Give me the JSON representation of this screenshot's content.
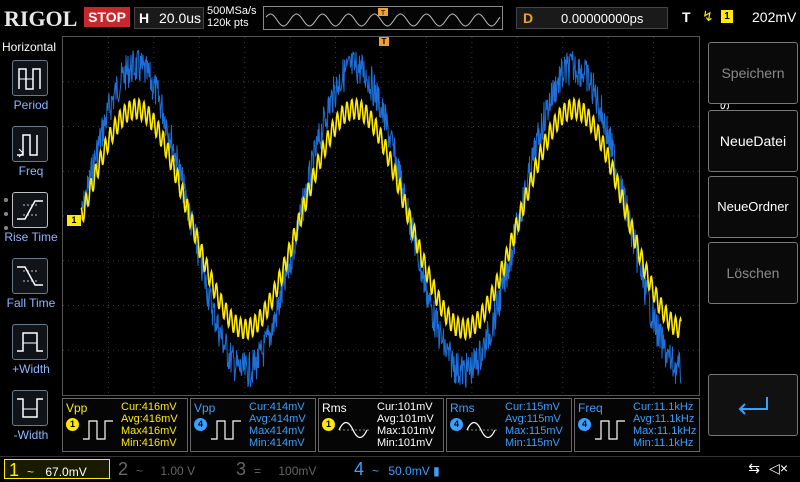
{
  "header": {
    "brand": "RIGOL",
    "run_state": "STOP",
    "horizontal_key": "H",
    "timebase": "20.0us",
    "sample_rate": "500MSa/s",
    "memory_depth": "120k pts",
    "delay_key": "D",
    "delay_value": "0.00000000ps",
    "trigger_key": "T",
    "trigger_edge": "↯",
    "trigger_channel": "1",
    "trigger_level": "202mV"
  },
  "left_menu": {
    "title": "Horizontal",
    "items": [
      {
        "label": "Period",
        "icon": "period-icon"
      },
      {
        "label": "Freq",
        "icon": "frequency-icon"
      },
      {
        "label": "Rise Time",
        "icon": "rise-time-icon"
      },
      {
        "label": "Fall Time",
        "icon": "fall-time-icon"
      },
      {
        "label": "+Width",
        "icon": "positive-width-icon"
      },
      {
        "label": "-Width",
        "icon": "negative-width-icon"
      }
    ]
  },
  "right_menu": {
    "title": "Speichern",
    "buttons": [
      {
        "label": "Speichern",
        "state": "dim"
      },
      {
        "label": "NeueDatei",
        "state": "on"
      },
      {
        "label": "NeueOrdner",
        "state": "on"
      },
      {
        "label": "Löschen",
        "state": "dim"
      }
    ],
    "back_icon": "return-arrow-icon"
  },
  "screen": {
    "ch1_marker": "1",
    "trigger_marker": "T",
    "ch1_color": "#ffea00",
    "ch4_color": "#1e6fd8",
    "grid_color": "#3a3a3a"
  },
  "measurements": [
    {
      "name": "Vpp",
      "channel": "1",
      "cur": "Cur:416mV",
      "avg": "Avg:416mV",
      "max": "Max416mV",
      "min": "Min:416mV",
      "color": "yellow",
      "wave": "pulse"
    },
    {
      "name": "Vpp",
      "channel": "4",
      "cur": "Cur:414mV",
      "avg": "Avg:414mV",
      "max": "Max414mV",
      "min": "Min:414mV",
      "color": "blue",
      "wave": "pulse"
    },
    {
      "name": "Rms",
      "channel": "1",
      "cur": "Cur:101mV",
      "avg": "Avg:101mV",
      "max": "Max:101mV",
      "min": "Min:101mV",
      "color": "yellow",
      "wave": "sine"
    },
    {
      "name": "Rms",
      "channel": "4",
      "cur": "Cur:115mV",
      "avg": "Avg:115mV",
      "max": "Max:115mV",
      "min": "Min:115mV",
      "color": "blue",
      "wave": "sine"
    },
    {
      "name": "Freq",
      "channel": "4",
      "cur": "Cur:11.1kHz",
      "avg": "Avg:11.1kHz",
      "max": "Max:11.1kHz",
      "min": "Min:11.1kHz",
      "color": "blue",
      "wave": "pulse"
    }
  ],
  "channels": [
    {
      "num": "1",
      "coupling": "~",
      "scale": "67.0mV",
      "active": true,
      "color": "#ffea00"
    },
    {
      "num": "2",
      "coupling": "~",
      "scale": "1.00 V",
      "active": false,
      "color": "#666666"
    },
    {
      "num": "3",
      "coupling": "=",
      "scale": "100mV",
      "active": false,
      "color": "#666666"
    },
    {
      "num": "4",
      "coupling": "~",
      "scale": "50.0mV",
      "active": true,
      "color": "#3aa0ff"
    }
  ],
  "status": {
    "usb_icon": "usb-icon",
    "mute_icon": "speaker-mute-icon"
  }
}
